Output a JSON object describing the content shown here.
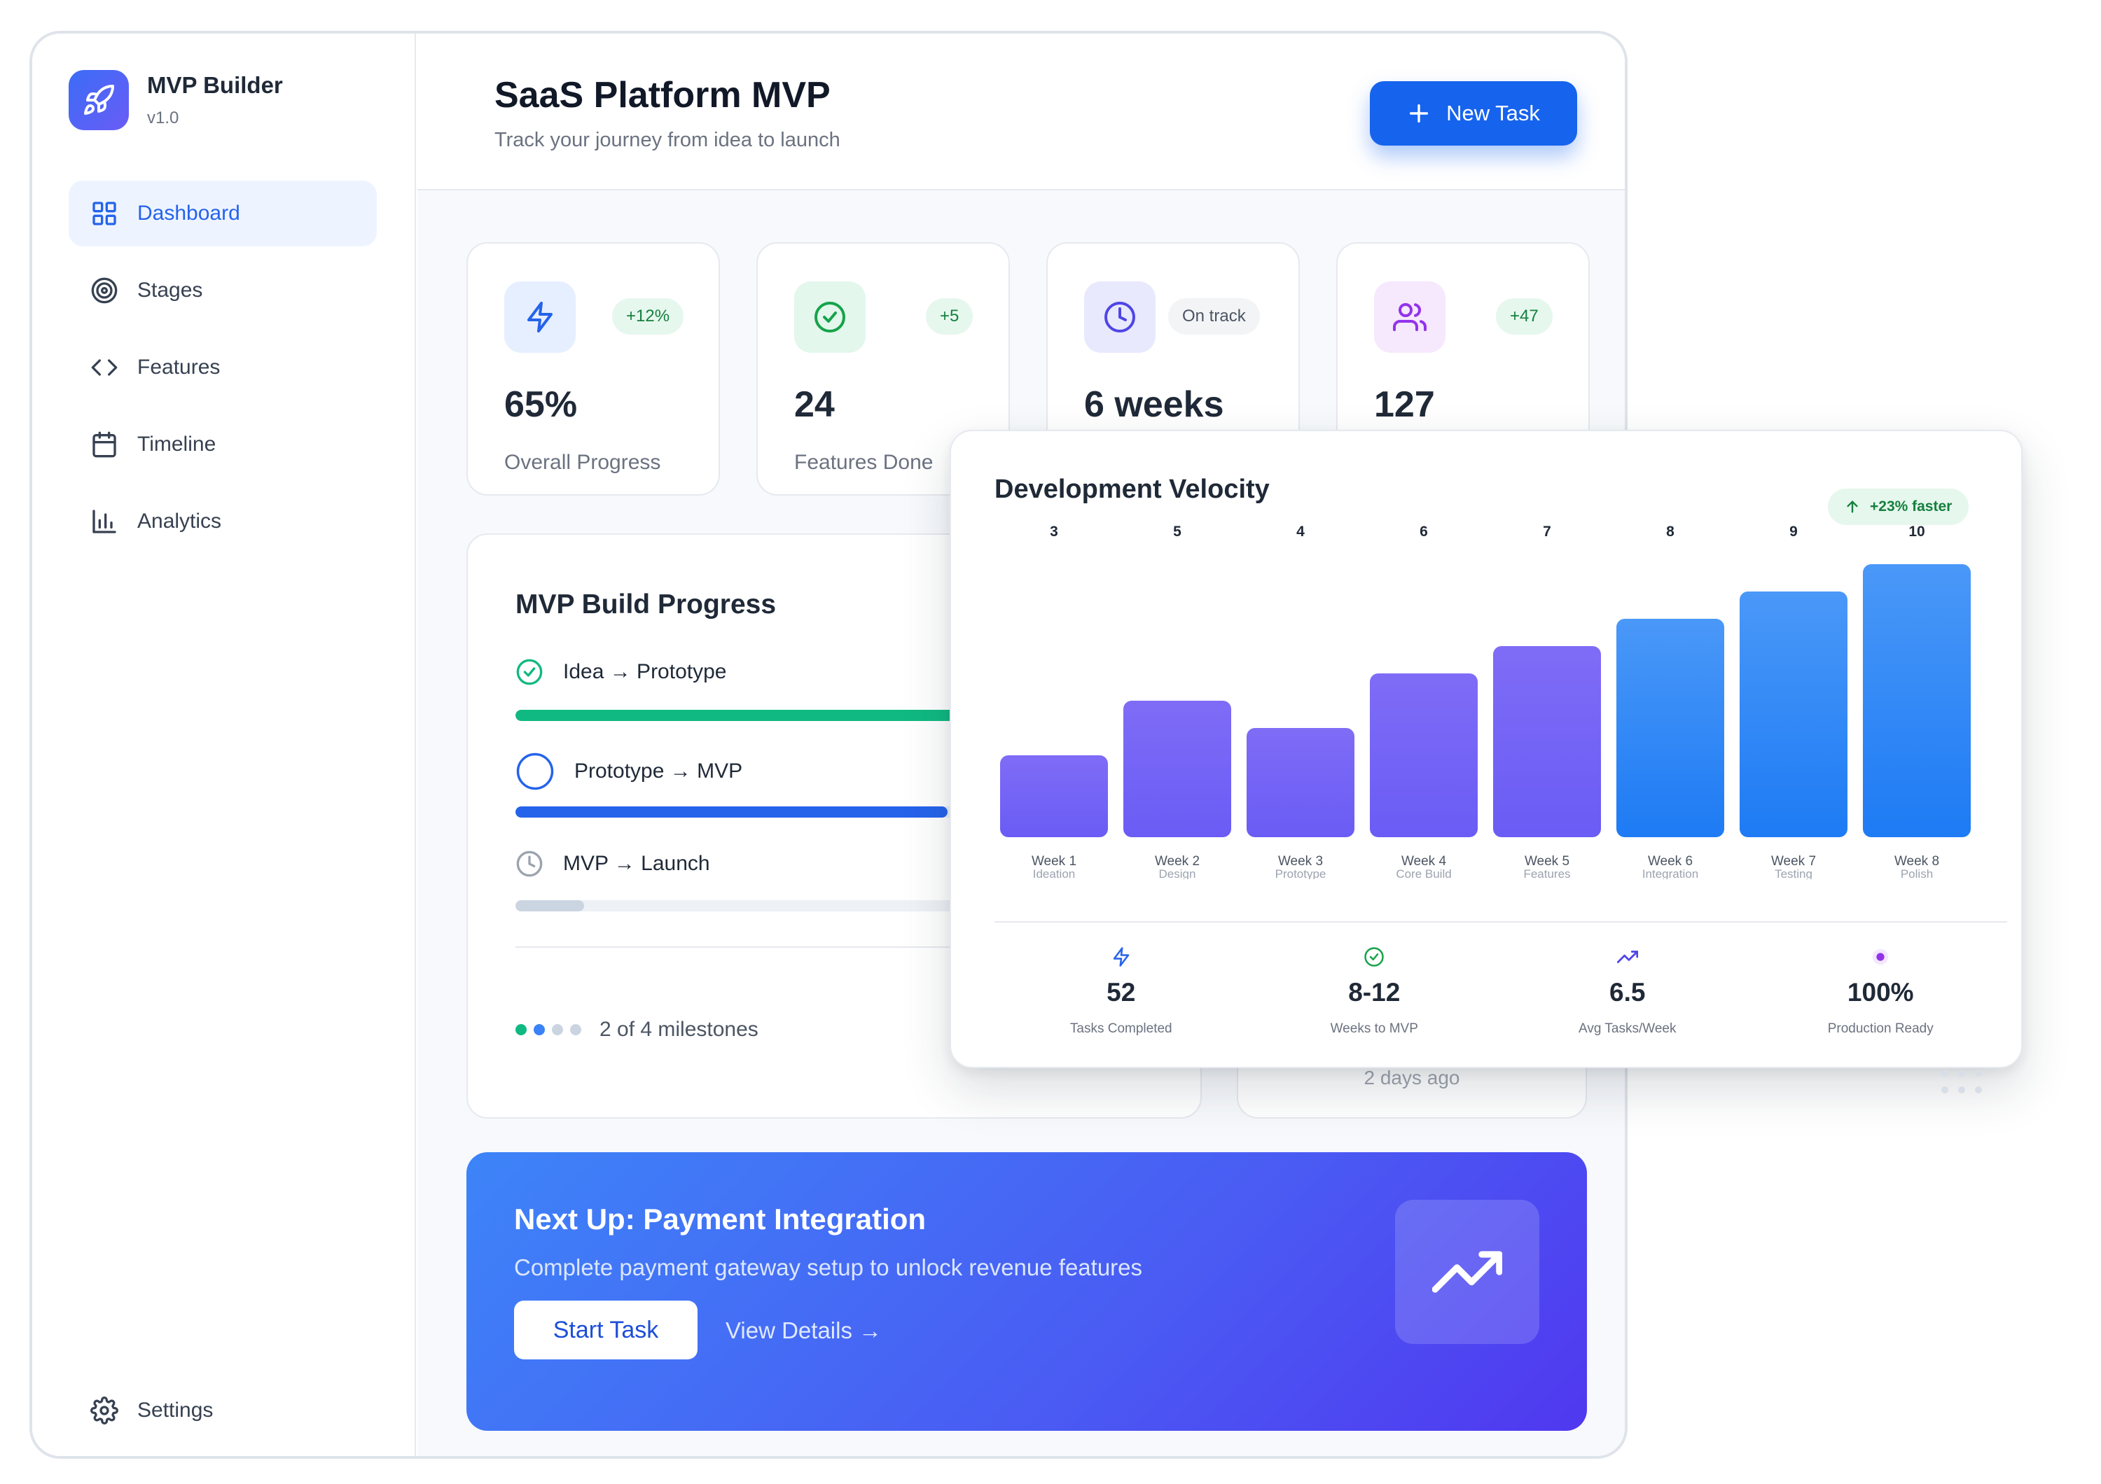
{
  "brand": {
    "name": "MVP Builder",
    "version": "v1.0",
    "accent": "#3b6cf6"
  },
  "sidebar": {
    "items": [
      {
        "label": "Dashboard",
        "icon": "grid-icon",
        "active": true
      },
      {
        "label": "Stages",
        "icon": "target-icon",
        "active": false
      },
      {
        "label": "Features",
        "icon": "code-icon",
        "active": false
      },
      {
        "label": "Timeline",
        "icon": "calendar-icon",
        "active": false
      },
      {
        "label": "Analytics",
        "icon": "bar-chart-icon",
        "active": false
      }
    ],
    "settings_label": "Settings"
  },
  "header": {
    "title": "SaaS Platform MVP",
    "subtitle": "Track your journey from idea to launch",
    "new_task_label": "New Task"
  },
  "stats": [
    {
      "value": "65%",
      "label": "Overall Progress",
      "badge": "+12%",
      "icon": "lightning-icon",
      "color": "#2563eb"
    },
    {
      "value": "24",
      "label": "Features Done",
      "badge": "+5",
      "icon": "check-circle-icon",
      "color": "#16a34a"
    },
    {
      "value": "6 weeks",
      "label": "",
      "badge": "On track",
      "icon": "clock-icon",
      "color": "#4f46e5"
    },
    {
      "value": "127",
      "label": "",
      "badge": "+47",
      "icon": "users-icon",
      "color": "#9333ea"
    }
  ],
  "build_progress": {
    "title": "MVP Build Progress",
    "milestones": [
      {
        "label": "Idea → Prototype",
        "status": "done",
        "progress": 1.0,
        "color": "#10b981"
      },
      {
        "label": "Prototype → MVP",
        "status": "in-progress",
        "progress": 0.63,
        "color": "#2563eb"
      },
      {
        "label": "MVP → Launch",
        "status": "pending",
        "progress": 0.1,
        "color": "#cbd5e1"
      }
    ],
    "summary": "2 of 4 milestones",
    "dot_colors": [
      "#10b981",
      "#3b82f6",
      "#cbd5e1",
      "#cbd5e1"
    ]
  },
  "side_card": {
    "time_text": "2 days ago"
  },
  "next_up": {
    "title": "Next Up: Payment Integration",
    "subtitle": "Complete payment gateway setup to unlock revenue features",
    "start_label": "Start Task",
    "details_label": "View Details →"
  },
  "velocity": {
    "title": "Development Velocity",
    "badge": "+23% faster",
    "summary": [
      {
        "value": "52",
        "label": "Tasks Completed",
        "icon": "lightning-icon",
        "color": "#2563eb"
      },
      {
        "value": "8-12",
        "label": "Weeks to MVP",
        "icon": "check-circle-icon",
        "color": "#16a34a"
      },
      {
        "value": "6.5",
        "label": "Avg Tasks/Week",
        "icon": "trending-up-icon",
        "color": "#4f46e5"
      },
      {
        "value": "100%",
        "label": "Production Ready",
        "icon": "dot-icon",
        "color": "#9333ea"
      }
    ]
  },
  "chart_data": {
    "type": "bar",
    "title": "Development Velocity",
    "categories": [
      "Week 1",
      "Week 2",
      "Week 3",
      "Week 4",
      "Week 5",
      "Week 6",
      "Week 7",
      "Week 8"
    ],
    "sublabels": [
      "Ideation",
      "Design",
      "Prototype",
      "Core Build",
      "Features",
      "Integration",
      "Testing",
      "Polish"
    ],
    "values": [
      3,
      5,
      4,
      6,
      7,
      8,
      9,
      10
    ],
    "ylim": [
      0,
      10
    ],
    "grid": false,
    "legend": "none",
    "bar_colors": [
      "#7a67f5",
      "#7a67f5",
      "#7a67f5",
      "#7a67f5",
      "#7a67f5",
      "#2b7ff5",
      "#2b7ff5",
      "#2b7ff5"
    ]
  }
}
